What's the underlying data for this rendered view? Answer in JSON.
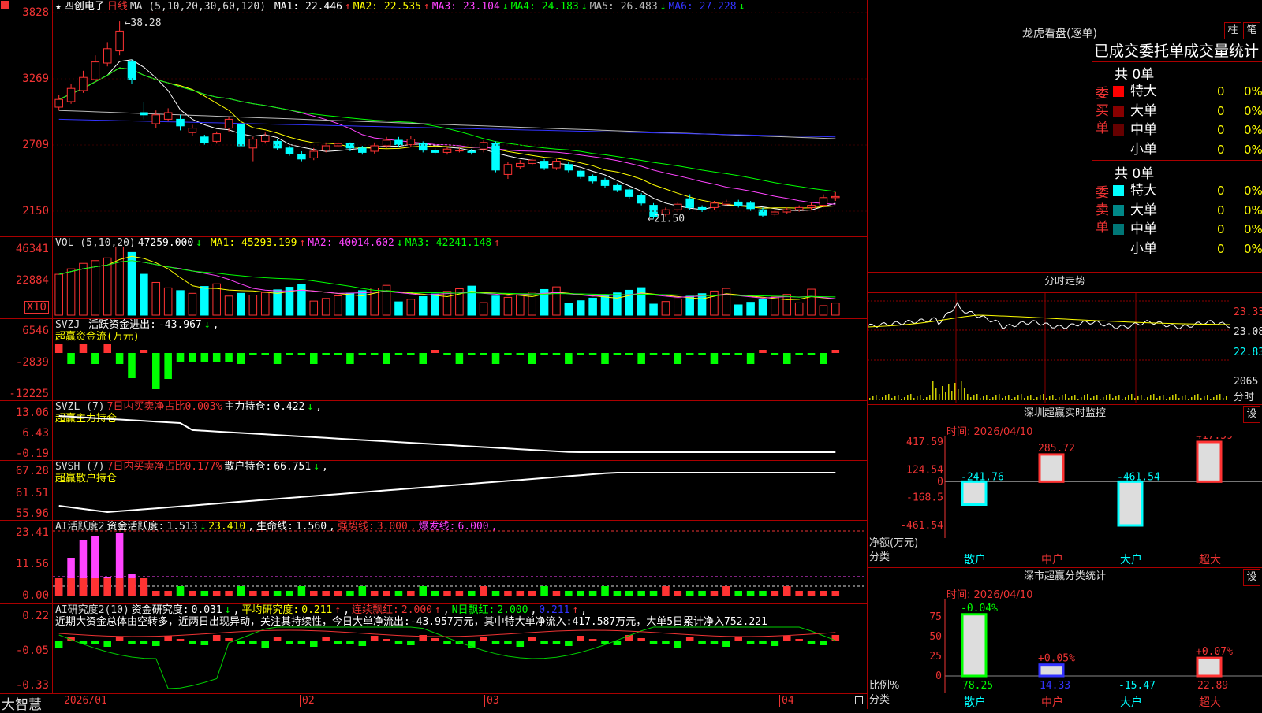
{
  "stock": {
    "name": "四创电子",
    "period": "日线"
  },
  "colors": {
    "up": "#ff3333",
    "down": "#00ffff",
    "green": "#00ff00",
    "axis": "#dd2222",
    "grid": "#8b0000"
  },
  "price_panel": {
    "ma_label": "MA (5,10,20,30,60,120)",
    "ma": [
      {
        "name": "MA1",
        "value": "22.446",
        "dir": "↑",
        "color": "#ffffff"
      },
      {
        "name": "MA2",
        "value": "22.535",
        "dir": "↑",
        "color": "#ffff00"
      },
      {
        "name": "MA3",
        "value": "23.104",
        "dir": "↓",
        "color": "#ff44ff"
      },
      {
        "name": "MA4",
        "value": "24.183",
        "dir": "↓",
        "color": "#00ff00"
      },
      {
        "name": "MA5",
        "value": "26.483",
        "dir": "↓",
        "color": "#bbbbbb"
      },
      {
        "name": "MA6",
        "value": "27.228",
        "dir": "↓",
        "color": "#3333ff"
      }
    ],
    "y_ticks": [
      "3828",
      "3269",
      "2709",
      "2150"
    ],
    "high_label": "38.28",
    "low_label": "21.50",
    "candles": [
      {
        "o": 30.5,
        "c": 31.2,
        "h": 31.6,
        "l": 30.2
      },
      {
        "o": 31.0,
        "c": 32.2,
        "h": 32.6,
        "l": 30.8
      },
      {
        "o": 32.0,
        "c": 33.2,
        "h": 33.8,
        "l": 31.8
      },
      {
        "o": 33.0,
        "c": 34.6,
        "h": 35.2,
        "l": 32.8
      },
      {
        "o": 34.5,
        "c": 35.8,
        "h": 36.4,
        "l": 34.2
      },
      {
        "o": 35.6,
        "c": 37.4,
        "h": 38.28,
        "l": 35.2
      },
      {
        "o": 34.6,
        "c": 33.0,
        "h": 34.8,
        "l": 32.6
      },
      {
        "o": 30.0,
        "c": 29.8,
        "h": 31.0,
        "l": 29.4
      },
      {
        "o": 29.0,
        "c": 29.8,
        "h": 30.2,
        "l": 28.6
      },
      {
        "o": 29.4,
        "c": 30.0,
        "h": 30.4,
        "l": 29.2
      },
      {
        "o": 29.4,
        "c": 28.8,
        "h": 29.8,
        "l": 28.4
      },
      {
        "o": 28.2,
        "c": 28.6,
        "h": 28.9,
        "l": 27.9
      },
      {
        "o": 27.8,
        "c": 27.3,
        "h": 28.0,
        "l": 27.1
      },
      {
        "o": 27.4,
        "c": 28.1,
        "h": 28.3,
        "l": 27.2
      },
      {
        "o": 28.6,
        "c": 29.4,
        "h": 29.6,
        "l": 28.3
      },
      {
        "o": 28.9,
        "c": 27.0,
        "h": 29.2,
        "l": 26.6
      },
      {
        "o": 26.8,
        "c": 27.6,
        "h": 27.8,
        "l": 25.6
      },
      {
        "o": 27.4,
        "c": 27.9,
        "h": 28.2,
        "l": 27.2
      },
      {
        "o": 27.4,
        "c": 26.8,
        "h": 27.6,
        "l": 26.6
      },
      {
        "o": 26.8,
        "c": 26.3,
        "h": 27.0,
        "l": 26.1
      },
      {
        "o": 26.2,
        "c": 25.8,
        "h": 26.5,
        "l": 25.6
      },
      {
        "o": 25.9,
        "c": 26.5,
        "h": 26.8,
        "l": 25.7
      },
      {
        "o": 26.6,
        "c": 27.0,
        "h": 27.3,
        "l": 26.4
      },
      {
        "o": 27.0,
        "c": 27.2,
        "h": 27.4,
        "l": 26.8
      },
      {
        "o": 27.2,
        "c": 26.8,
        "h": 27.3,
        "l": 26.5
      },
      {
        "o": 26.8,
        "c": 26.4,
        "h": 27.0,
        "l": 26.2
      },
      {
        "o": 26.5,
        "c": 27.0,
        "h": 27.3,
        "l": 26.3
      },
      {
        "o": 27.0,
        "c": 27.5,
        "h": 27.8,
        "l": 26.8
      },
      {
        "o": 27.5,
        "c": 27.1,
        "h": 27.8,
        "l": 26.9
      },
      {
        "o": 27.1,
        "c": 27.6,
        "h": 27.9,
        "l": 26.9
      },
      {
        "o": 27.2,
        "c": 26.6,
        "h": 27.4,
        "l": 26.4
      },
      {
        "o": 26.6,
        "c": 26.4,
        "h": 26.8,
        "l": 26.2
      },
      {
        "o": 26.4,
        "c": 26.7,
        "h": 26.9,
        "l": 26.2
      },
      {
        "o": 26.6,
        "c": 26.6,
        "h": 26.8,
        "l": 26.4
      },
      {
        "o": 26.5,
        "c": 26.4,
        "h": 26.7,
        "l": 26.2
      },
      {
        "o": 26.7,
        "c": 27.3,
        "h": 27.5,
        "l": 26.4
      },
      {
        "o": 27.2,
        "c": 24.8,
        "h": 27.4,
        "l": 24.6
      },
      {
        "o": 24.4,
        "c": 25.3,
        "h": 25.5,
        "l": 24.0
      },
      {
        "o": 25.1,
        "c": 25.4,
        "h": 25.7,
        "l": 24.9
      },
      {
        "o": 25.4,
        "c": 25.7,
        "h": 25.9,
        "l": 25.2
      },
      {
        "o": 25.6,
        "c": 25.0,
        "h": 25.8,
        "l": 24.8
      },
      {
        "o": 25.0,
        "c": 25.6,
        "h": 25.8,
        "l": 24.8
      },
      {
        "o": 25.3,
        "c": 24.8,
        "h": 25.5,
        "l": 24.6
      },
      {
        "o": 24.7,
        "c": 24.2,
        "h": 24.9,
        "l": 24.0
      },
      {
        "o": 24.2,
        "c": 23.8,
        "h": 24.4,
        "l": 23.6
      },
      {
        "o": 23.9,
        "c": 23.4,
        "h": 24.1,
        "l": 23.2
      },
      {
        "o": 23.4,
        "c": 23.0,
        "h": 23.6,
        "l": 22.8
      },
      {
        "o": 23.0,
        "c": 22.4,
        "h": 23.2,
        "l": 22.2
      },
      {
        "o": 22.5,
        "c": 21.8,
        "h": 22.7,
        "l": 21.6
      },
      {
        "o": 21.6,
        "c": 20.6,
        "h": 21.8,
        "l": 20.4
      },
      {
        "o": 20.8,
        "c": 21.2,
        "h": 21.4,
        "l": 20.6
      },
      {
        "o": 21.2,
        "c": 21.7,
        "h": 21.9,
        "l": 21.0
      },
      {
        "o": 22.2,
        "c": 21.4,
        "h": 22.6,
        "l": 21.2
      },
      {
        "o": 21.4,
        "c": 21.2,
        "h": 21.6,
        "l": 21.0
      },
      {
        "o": 21.4,
        "c": 21.8,
        "h": 22.0,
        "l": 21.2
      },
      {
        "o": 21.7,
        "c": 21.9,
        "h": 22.1,
        "l": 21.5
      },
      {
        "o": 21.9,
        "c": 21.6,
        "h": 22.1,
        "l": 21.4
      },
      {
        "o": 21.8,
        "c": 21.3,
        "h": 22.0,
        "l": 21.1
      },
      {
        "o": 21.2,
        "c": 20.7,
        "h": 21.4,
        "l": 20.5
      },
      {
        "o": 20.8,
        "c": 21.0,
        "h": 21.2,
        "l": 20.6
      },
      {
        "o": 21.0,
        "c": 21.2,
        "h": 21.4,
        "l": 20.8
      },
      {
        "o": 21.2,
        "c": 21.4,
        "h": 21.6,
        "l": 21.0
      },
      {
        "o": 21.4,
        "c": 21.6,
        "h": 21.9,
        "l": 21.2
      },
      {
        "o": 21.6,
        "c": 22.3,
        "h": 22.6,
        "l": 21.4
      },
      {
        "o": 22.3,
        "c": 22.4,
        "h": 22.8,
        "l": 22.0
      }
    ]
  },
  "vol_panel": {
    "label": "VOL (5,10,20)",
    "value": "47259.000",
    "dir": "↓",
    "ma": [
      {
        "name": "MA1",
        "value": "45293.199",
        "dir": "↑",
        "color": "#ffff00"
      },
      {
        "name": "MA2",
        "value": "40014.602",
        "dir": "↓",
        "color": "#ff44ff"
      },
      {
        "name": "MA3",
        "value": "42241.148",
        "dir": "↑",
        "color": "#00ff00"
      }
    ],
    "y_ticks": [
      "46341",
      "22884"
    ],
    "unit": "X10"
  },
  "svzj": {
    "label": "SVZJ",
    "title": "活跃资金进出:",
    "value": "-43.967",
    "dir": "↓",
    "sub": "超赢资金流(万元)",
    "y_ticks": [
      "6546",
      "-2839",
      "-12225"
    ]
  },
  "svzl": {
    "label": "SVZL (7)",
    "desc": "7日内买卖净占比0.003%",
    "title": "主力持仓:",
    "value": "0.422",
    "dir": "↓",
    "sub": "超赢主力持仓",
    "y_ticks": [
      "13.06",
      "6.43",
      "-0.19"
    ]
  },
  "svsh": {
    "label": "SVSH (7)",
    "desc": "7日内买卖净占比0.177%",
    "title": "散户持仓:",
    "value": "66.751",
    "dir": "↓",
    "sub": "超赢散户持仓",
    "y_ticks": [
      "67.28",
      "61.51",
      "55.96"
    ]
  },
  "ai1": {
    "label": "AI活跃度2",
    "t1": "资金活跃度:",
    "v1": "1.513",
    "d1": "↓",
    "v2": "23.410",
    "t3": "生命线:",
    "v3": "1.560",
    "t4": "强势线:",
    "v4": "3.000",
    "t5": "爆发线:",
    "v5": "6.000",
    "y_ticks": [
      "23.41",
      "11.56",
      "0.00"
    ]
  },
  "ai2": {
    "label": "AI研究度2(10)",
    "t1": "资金研究度:",
    "v1": "0.031",
    "d1": "↓",
    "t2": "平均研究度:",
    "v2": "0.211",
    "d2": "↑",
    "t3": "连续飘红:",
    "v3": "2.000",
    "d3": "↑",
    "t4": "N日飘红:",
    "v4": "2.000",
    "v5": "0.211",
    "d5": "↑",
    "comment": "近期大资金总体由空转多，近两日出现异动，关注其持续性，今日大单净流出:-43.957万元，其中特大单净流入:417.587万元，大单5日累计净入752.221",
    "y_ticks": [
      "0.22",
      "-0.05",
      "-0.33"
    ]
  },
  "x_axis": {
    "labels": [
      "2026/01",
      "02",
      "03",
      "04"
    ],
    "brand": "大智慧"
  },
  "right": {
    "longhu_title": "龙虎看盘(逐单)",
    "btn_zhu": "柱",
    "btn_bi": "笔",
    "stats_title": "已成交委托单成交量统计",
    "buy": {
      "side": "委买单",
      "total": "共 0单",
      "rows": [
        {
          "name": "特大",
          "v": "0",
          "p": "0%",
          "color": "#ff0000"
        },
        {
          "name": "大单",
          "v": "0",
          "p": "0%",
          "color": "#880000"
        },
        {
          "name": "中单",
          "v": "0",
          "p": "0%",
          "color": "#660000"
        },
        {
          "name": "小单",
          "v": "0",
          "p": "0%",
          "color": "#000000"
        }
      ]
    },
    "sell": {
      "side": "委卖单",
      "total": "共 0单",
      "rows": [
        {
          "name": "特大",
          "v": "0",
          "p": "0%",
          "color": "#00ffff"
        },
        {
          "name": "大单",
          "v": "0",
          "p": "0%",
          "color": "#008888"
        },
        {
          "name": "中单",
          "v": "0",
          "p": "0%",
          "color": "#007777"
        },
        {
          "name": "小单",
          "v": "0",
          "p": "0%",
          "color": "#000000"
        }
      ]
    },
    "intraday": {
      "title": "分时走势",
      "y": [
        "23.33",
        "23.08",
        "22.83"
      ],
      "vol": "2065",
      "vol_unit": "分时"
    },
    "monitor": {
      "title": "深圳超赢实时监控",
      "date": "时间: 2026/04/10",
      "set": "设",
      "y": [
        "417.59",
        "124.54",
        "0",
        "-168.5",
        "-461.54"
      ],
      "label_y": "净额(万元)",
      "label_x": "分类",
      "bars": [
        {
          "cat": "散户",
          "v": -241.76,
          "label": "-241.76"
        },
        {
          "cat": "中户",
          "v": 285.72,
          "label": "285.72"
        },
        {
          "cat": "大户",
          "v": -461.54,
          "label": "-461.54"
        },
        {
          "cat": "超大",
          "v": 417.59,
          "label": "417.59"
        }
      ]
    },
    "classify": {
      "title": "深市超赢分类统计",
      "date": "时间: 2026/04/10",
      "set": "设",
      "y": [
        "75",
        "50",
        "25",
        "0"
      ],
      "label_y": "比例%",
      "label_x": "分类",
      "bars": [
        {
          "cat": "散户",
          "v": 78.25,
          "label": "78.25",
          "top": "-0.04%"
        },
        {
          "cat": "中户",
          "v": 14.33,
          "label": "14.33",
          "top": "+0.05%"
        },
        {
          "cat": "大户",
          "v": -15.47,
          "label": "-15.47",
          "top": ""
        },
        {
          "cat": "超大",
          "v": 22.89,
          "label": "22.89",
          "top": "+0.07%"
        }
      ]
    }
  }
}
